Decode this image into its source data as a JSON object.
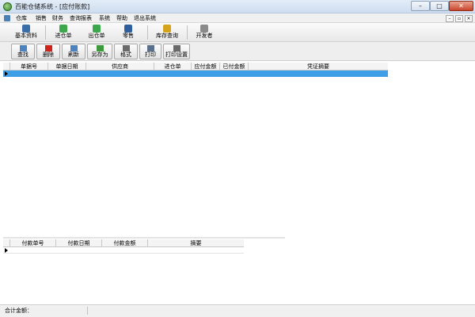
{
  "window": {
    "title": "百能仓储系统 - [应付账款]",
    "min_glyph": "–",
    "max_glyph": "□",
    "close_glyph": "✕"
  },
  "menu": {
    "items": [
      "仓库",
      "销售",
      "财务",
      "查询报表",
      "系统",
      "帮助",
      "退出系统"
    ],
    "mdi_min": "–",
    "mdi_restore": "▫",
    "mdi_close": "×"
  },
  "toolbar1": {
    "buttons": [
      {
        "label": "基本资料",
        "icon": "info-icon",
        "color": "#3a6ea8"
      },
      {
        "label": "进仓单",
        "icon": "arrows-in-icon",
        "color": "#3aa84b"
      },
      {
        "label": "出仓单",
        "icon": "arrows-out-icon",
        "color": "#3aa84b"
      },
      {
        "label": "零售",
        "icon": "cart-icon",
        "color": "#2e5f9e"
      },
      {
        "label": "库存查询",
        "icon": "search-box-icon",
        "color": "#d4a21b"
      },
      {
        "label": "开发者",
        "icon": "person-icon",
        "color": "#8a8a8a"
      }
    ]
  },
  "toolbar2": {
    "buttons": [
      {
        "label": "查找",
        "icon": "magnifier-icon",
        "color": "#4a82c2"
      },
      {
        "label": "删除",
        "icon": "delete-x-icon",
        "color": "#d0231a"
      },
      {
        "label": "刷新",
        "icon": "refresh-icon",
        "color": "#4a82c2"
      },
      {
        "label": "另存为",
        "icon": "save-as-icon",
        "color": "#3c9a3c"
      },
      {
        "label": "格式",
        "icon": "format-icon",
        "color": "#6a6a6a"
      },
      {
        "label": "打印",
        "icon": "printer-icon",
        "color": "#5a6f8c"
      },
      {
        "label": "打印设置",
        "icon": "print-settings-icon",
        "color": "#6a6a6a"
      }
    ]
  },
  "payables_table": {
    "columns": [
      "单据号",
      "单据日期",
      "供应商",
      "进仓单",
      "应付金额",
      "已付金额",
      "凭证摘要"
    ]
  },
  "payments_table": {
    "columns": [
      "付款单号",
      "付款日期",
      "付款金额",
      "摘要"
    ]
  },
  "status": {
    "total_label": "合计金额："
  },
  "colors": {
    "selection": "#3e9fe7",
    "titlebar": "#cdddf0"
  }
}
